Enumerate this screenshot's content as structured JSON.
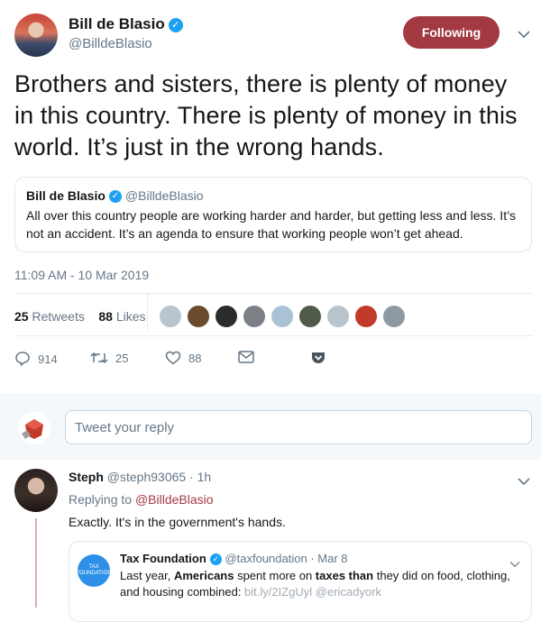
{
  "tweet": {
    "author_name": "Bill de Blasio",
    "author_handle": "@BilldeBlasio",
    "follow_label": "Following",
    "text": "Brothers and sisters, there is plenty of money in this country. There is plenty of money in this world. It’s just in the wrong hands.",
    "quoted": {
      "author_name": "Bill de Blasio",
      "author_handle": "@BilldeBlasio",
      "text": "All over this country people are working harder and harder, but getting less and less. It’s not an accident. It’s an agenda to ensure that working people won’t get ahead."
    },
    "timestamp": "11:09 AM - 10 Mar 2019",
    "retweets_count": "25",
    "retweets_label": "Retweets",
    "likes_count": "88",
    "likes_label": "Likes",
    "actions": {
      "reply_count": "914",
      "retweet_count": "25",
      "like_count": "88"
    }
  },
  "reply_box": {
    "placeholder": "Tweet your reply"
  },
  "reply": {
    "author_name": "Steph",
    "author_handle": "@steph93065",
    "time": "· 1h",
    "replying_prefix": "Replying to",
    "replying_to": "@BilldeBlasio",
    "text": "Exactly. It's in the government's hands.",
    "quoted": {
      "author_name": "Tax Foundation",
      "author_handle": "@taxfoundation",
      "date": "· Mar 8",
      "avatar_text": "TAX FOUNDATION",
      "text_a": "Last year, ",
      "text_b": "Americans",
      "text_c": " spent more on ",
      "text_d": "taxes than",
      "text_e": " they did on food, clothing, and housing combined: ",
      "link": "bit.ly/2IZgUyl @ericadyork"
    }
  },
  "colors": {
    "accent": "#a33a42",
    "verified": "#1da1f2"
  }
}
